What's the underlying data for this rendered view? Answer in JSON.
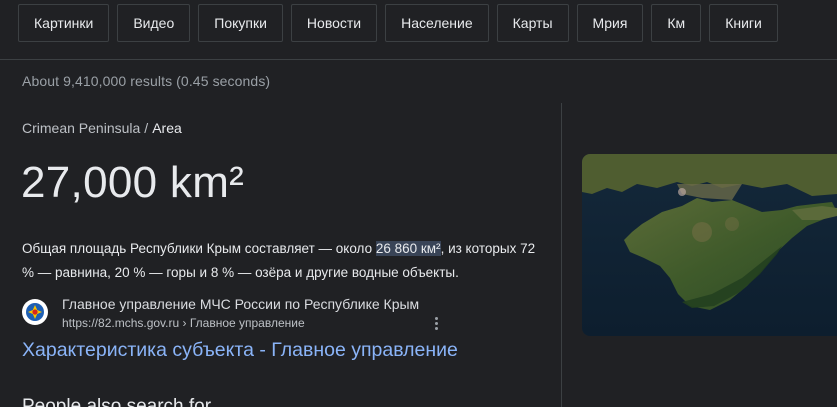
{
  "chips": [
    "Картинки",
    "Видео",
    "Покупки",
    "Новости",
    "Население",
    "Карты",
    "Мрия",
    "Км",
    "Книги"
  ],
  "stats": "About 9,410,000 results (0.45 seconds)",
  "breadcrumb": {
    "parent": "Crimean Peninsula",
    "separator": "/",
    "current": "Area"
  },
  "answer": "27,000 km²",
  "snippet": {
    "before": "Общая площадь Республики Крым составляет — около ",
    "highlight": "26 860 км²",
    "after": ", из которых 72 % — равнина, 20 % — горы и 8 % — озёра и другие водные объекты."
  },
  "source": {
    "name": "Главное управление МЧС России по Республике Крым",
    "url": "https://82.mchs.gov.ru › Главное управление",
    "favicon_icon": "mchs-emblem-icon",
    "more_icon": "more-vert-icon"
  },
  "result_title": "Характеристика субъекта - Главное управление",
  "people_also_search": "People also search for",
  "colors": {
    "background": "#202124",
    "link": "#8ab4f8",
    "highlight": "#394457"
  }
}
